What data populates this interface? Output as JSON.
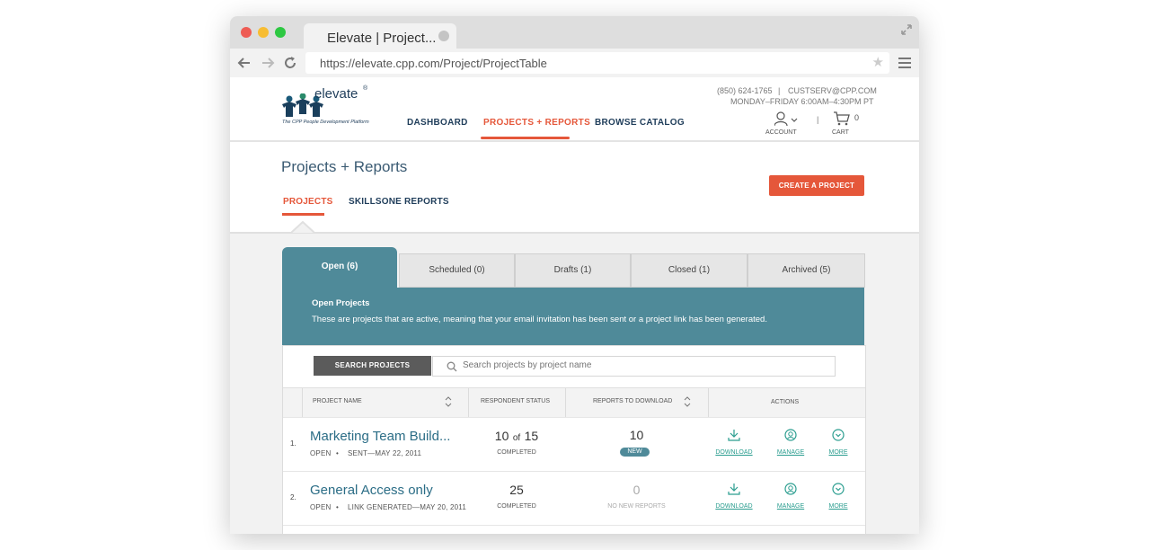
{
  "browser": {
    "tab_title": "Elevate | Project...",
    "url": "https://elevate.cpp.com/Project/ProjectTable"
  },
  "brand": {
    "name": "elevate",
    "mark": "®",
    "tagline": "The CPP People Development Platform",
    "accent": "#e5573a",
    "teal": "#4f8a99"
  },
  "header": {
    "phone": "(850) 624-1765",
    "email": "CUSTSERV@CPP.COM",
    "hours": "MONDAY–FRIDAY  6:00AM–4:30PM PT",
    "nav": [
      "DASHBOARD",
      "PROJECTS + REPORTS",
      "BROWSE CATALOG"
    ],
    "account_label": "ACCOUNT",
    "cart_label": "CART",
    "cart_count": "0"
  },
  "page": {
    "title": "Projects + Reports",
    "tabs": [
      "PROJECTS",
      "SKILLSONE REPORTS"
    ],
    "create_button": "CREATE A PROJECT"
  },
  "status_tabs": [
    {
      "label": "Open (6)",
      "active": true
    },
    {
      "label": "Scheduled (0)",
      "active": false
    },
    {
      "label": "Drafts (1)",
      "active": false
    },
    {
      "label": "Closed (1)",
      "active": false
    },
    {
      "label": "Archived (5)",
      "active": false
    }
  ],
  "panel": {
    "heading": "Open Projects",
    "description": "These are projects that are active, meaning that your email invitation has been sent or a project link has been generated."
  },
  "search": {
    "button": "SEARCH PROJECTS",
    "placeholder": "Search projects by project name"
  },
  "table": {
    "headers": [
      "PROJECT NAME",
      "RESPONDENT STATUS",
      "REPORTS TO DOWNLOAD",
      "ACTIONS"
    ],
    "rows": [
      {
        "index": "1.",
        "name": "Marketing Team Build...",
        "status": "OPEN",
        "detail": "SENT—MAY 22, 2011",
        "resp_count": "10",
        "resp_of": "of",
        "resp_total": "15",
        "resp_label": "COMPLETED",
        "reports": "10",
        "reports_badge": "NEW",
        "actions": [
          "DOWNLOAD",
          "MANAGE",
          "MORE"
        ]
      },
      {
        "index": "2.",
        "name": "General Access only",
        "status": "OPEN",
        "detail": "LINK GENERATED—MAY 20, 2011",
        "resp_count": "25",
        "resp_label": "COMPLETED",
        "reports": "0",
        "reports_note": "NO NEW REPORTS",
        "actions": [
          "DOWNLOAD",
          "MANAGE",
          "MORE"
        ]
      }
    ]
  }
}
